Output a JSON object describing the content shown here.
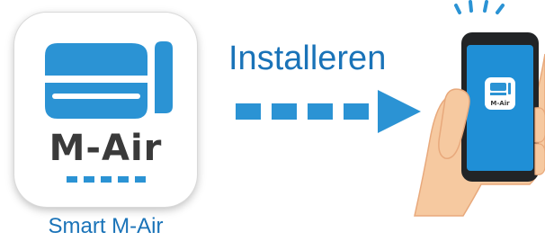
{
  "app_icon": {
    "logo_text": "M-Air",
    "icon": "air-conditioner-icon",
    "name": "Smart M-Air"
  },
  "action": {
    "label": "Installeren",
    "arrow_icon": "dashed-right-arrow-icon"
  },
  "phone": {
    "icon": "phone-in-hand-icon",
    "screen_app_text": "M-Air",
    "signal_icon": "signal-waves-icon"
  },
  "colors": {
    "brand_blue": "#2b93d4",
    "label_blue": "#1a73b8",
    "logo_text": "#3a3a3a",
    "skin": "#f6c9a0"
  }
}
